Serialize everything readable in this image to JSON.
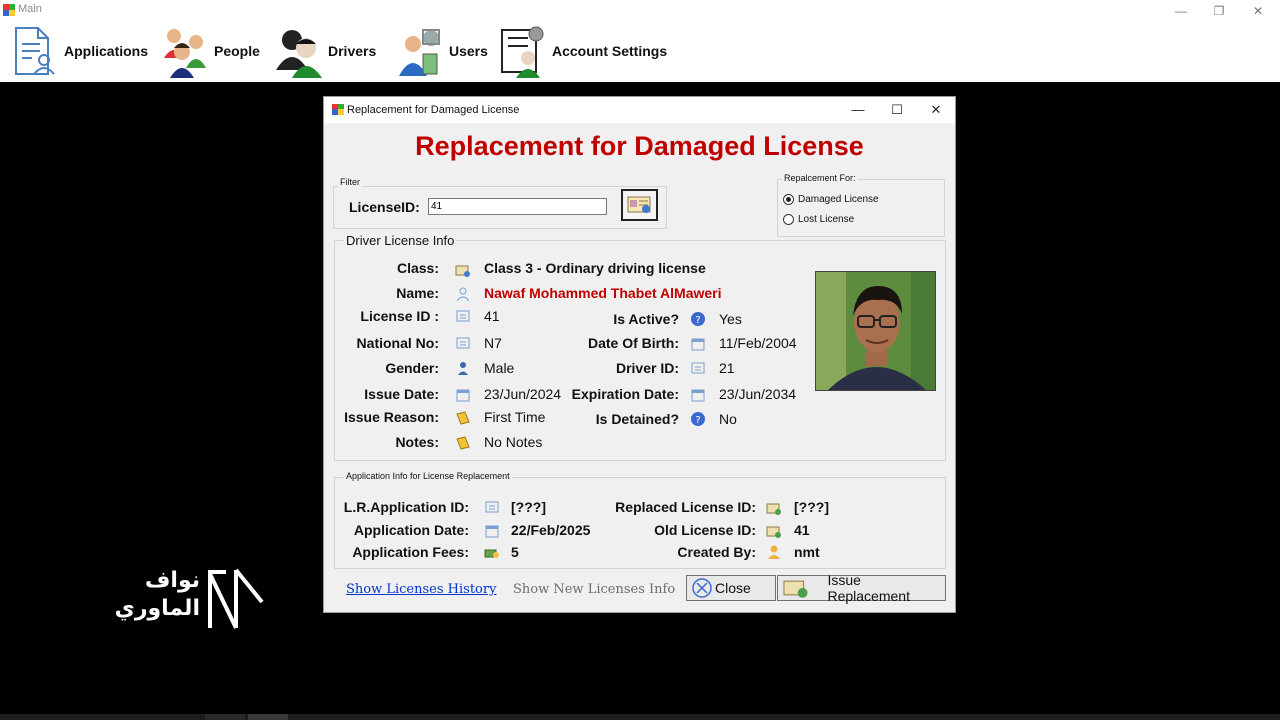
{
  "main_window": {
    "title": "Main",
    "menu": [
      {
        "label": "Applications",
        "icon": "applications-icon"
      },
      {
        "label": "People",
        "icon": "people-icon"
      },
      {
        "label": "Drivers",
        "icon": "drivers-icon"
      },
      {
        "label": "Users",
        "icon": "users-icon"
      },
      {
        "label": "Account Settings",
        "icon": "account-settings-icon"
      }
    ],
    "window_buttons": {
      "minimize": "—",
      "restore": "❐",
      "close": "✕"
    }
  },
  "watermark": {
    "text_line1": "نواف",
    "text_line2": "الماوري"
  },
  "dialog": {
    "title": "Replacement for Damaged License",
    "heading": "Replacement for Damaged License",
    "filter": {
      "legend": "Filter",
      "label": "LicenseID:",
      "value": "41",
      "search_icon": "license-search-icon"
    },
    "replacement_for": {
      "legend": "Repalcement For:",
      "options": [
        {
          "label": "Damaged License",
          "selected": true
        },
        {
          "label": "Lost License",
          "selected": false
        }
      ]
    },
    "driver_license_info": {
      "legend": "Driver License Info",
      "class_label": "Class:",
      "class_value": "Class 3 - Ordinary driving license",
      "name_label": "Name:",
      "name_value": "Nawaf Mohammed Thabet AlMaweri",
      "license_id_label": "License ID :",
      "license_id_value": "41",
      "is_active_label": "Is Active?",
      "is_active_value": "Yes",
      "national_no_label": "National No:",
      "national_no_value": "N7",
      "dob_label": "Date Of Birth:",
      "dob_value": "11/Feb/2004",
      "gender_label": "Gender:",
      "gender_value": "Male",
      "driver_id_label": "Driver ID:",
      "driver_id_value": "21",
      "issue_date_label": "Issue Date:",
      "issue_date_value": "23/Jun/2024",
      "expiration_date_label": "Expiration Date:",
      "expiration_date_value": "23/Jun/2034",
      "issue_reason_label": "Issue Reason:",
      "issue_reason_value": "First Time",
      "is_detained_label": "Is Detained?",
      "is_detained_value": "No",
      "notes_label": "Notes:",
      "notes_value": "No Notes"
    },
    "application_info": {
      "legend": "Application Info for License Replacement",
      "lr_app_id_label": "L.R.Application ID:",
      "lr_app_id_value": "[???]",
      "replaced_license_id_label": "Replaced License ID:",
      "replaced_license_id_value": "[???]",
      "app_date_label": "Application Date:",
      "app_date_value": "22/Feb/2025",
      "old_license_id_label": "Old License ID:",
      "old_license_id_value": "41",
      "app_fees_label": "Application Fees:",
      "app_fees_value": "5",
      "created_by_label": "Created By:",
      "created_by_value": "nmt"
    },
    "footer": {
      "show_history": "Show Licenses History",
      "show_new_info": "Show New Licenses Info",
      "close": "Close",
      "issue": "Issue Replacement"
    }
  },
  "colors": {
    "heading": "#c00000",
    "name": "#c00000",
    "link": "#0033cc"
  }
}
